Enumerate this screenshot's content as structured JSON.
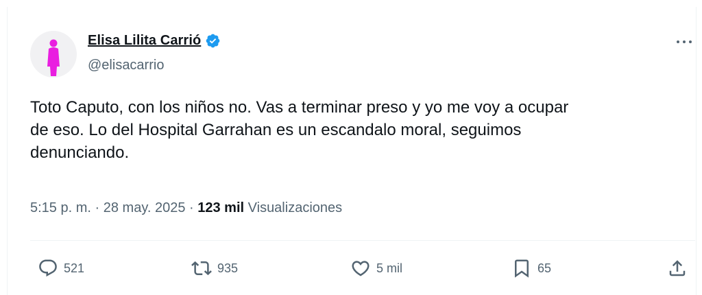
{
  "user": {
    "display_name": "Elisa Lilita Carrió",
    "handle": "@elisacarrio",
    "verified": true,
    "avatar_color": "#e91ee0",
    "verified_color": "#1d9bf0"
  },
  "tweet": {
    "text_lines": [
      "Toto Caputo, con los niños no. Vas a terminar preso y yo me voy a ocupar",
      "de eso. Lo del Hospital Garrahan es un escandalo moral, seguimos",
      "denunciando."
    ],
    "time": "5:15 p. m.",
    "separator": "·",
    "date": "28 may. 2025",
    "views_count": "123 mil",
    "views_label": "Visualizaciones"
  },
  "actions": {
    "replies": "521",
    "retweets": "935",
    "likes": "5 mil",
    "bookmarks": "65"
  },
  "icons": {
    "more": "more-horizontal-icon",
    "reply": "reply-icon",
    "retweet": "retweet-icon",
    "like": "heart-icon",
    "bookmark": "bookmark-icon",
    "share": "share-icon"
  }
}
